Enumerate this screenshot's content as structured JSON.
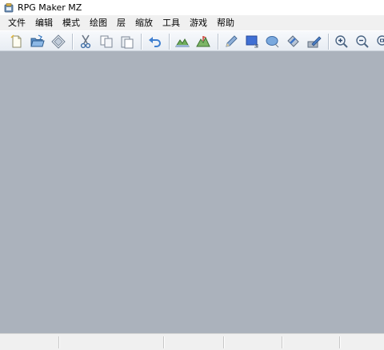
{
  "window": {
    "title": "RPG Maker MZ",
    "icon": "rpg-maker-app-icon"
  },
  "menu": {
    "items": [
      "文件",
      "编辑",
      "模式",
      "绘图",
      "层",
      "缩放",
      "工具",
      "游戏",
      "帮助"
    ]
  },
  "toolbar": {
    "buttons": [
      {
        "name": "new-project",
        "icon": "new-document-icon"
      },
      {
        "name": "open-project",
        "icon": "open-folder-icon"
      },
      {
        "name": "save-project",
        "icon": "save-diamond-icon"
      },
      {
        "name": "cut",
        "icon": "scissors-icon"
      },
      {
        "name": "copy",
        "icon": "copy-icon"
      },
      {
        "name": "paste",
        "icon": "paste-icon"
      },
      {
        "name": "undo",
        "icon": "undo-arrow-icon"
      },
      {
        "name": "map-mode",
        "icon": "map-mode-icon"
      },
      {
        "name": "event-mode",
        "icon": "event-mode-icon"
      },
      {
        "name": "pencil",
        "icon": "pencil-icon"
      },
      {
        "name": "rectangle",
        "icon": "rectangle-icon"
      },
      {
        "name": "ellipse",
        "icon": "ellipse-icon"
      },
      {
        "name": "fill",
        "icon": "fill-icon"
      },
      {
        "name": "shadow-pen",
        "icon": "shadow-pen-icon"
      },
      {
        "name": "zoom-in",
        "icon": "zoom-in-icon"
      },
      {
        "name": "zoom-out",
        "icon": "zoom-out-icon"
      },
      {
        "name": "zoom-actual",
        "icon": "zoom-actual-icon"
      }
    ]
  },
  "colors": {
    "workspace": "#abb2bc",
    "toolbar_top": "#f7f9fc",
    "toolbar_bottom": "#e8edf3",
    "menubar": "#f0f0f0",
    "statusbar": "#f0f0f0"
  },
  "statusbar": {
    "cells": [
      "",
      "",
      "",
      "",
      ""
    ]
  }
}
